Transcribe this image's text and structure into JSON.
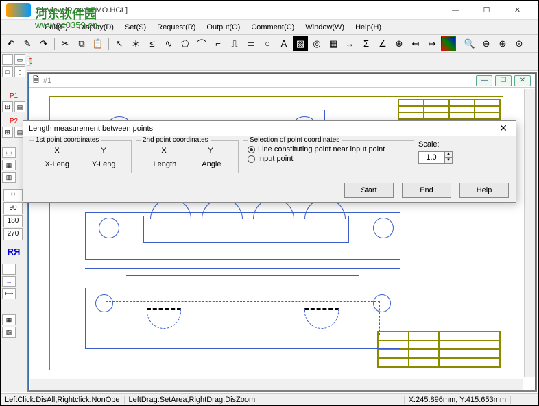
{
  "window": {
    "title": "PlcView [PlcxxDEMO.HGL]"
  },
  "menu": {
    "items": [
      "Edit(E)",
      "Display(D)",
      "Set(S)",
      "Request(R)",
      "Output(O)",
      "Comment(C)",
      "Window(W)",
      "Help(H)"
    ]
  },
  "child": {
    "title": "#1"
  },
  "rotation_buttons": [
    "0",
    "90",
    "180",
    "270"
  ],
  "dialog": {
    "title": "Length measurement between points",
    "group1_label": "1st point coordinates",
    "group2_label": "2nd point coordinates",
    "x_label": "X",
    "y_label": "Y",
    "xleng": "X-Leng",
    "yleng": "Y-Leng",
    "length": "Length",
    "angle": "Angle",
    "sel_label": "Selection of point coordinates",
    "radio1": "Line constituting point near input point",
    "radio2": "Input point",
    "scale_label": "Scale:",
    "scale_value": "1.0",
    "buttons": {
      "start": "Start",
      "end": "End",
      "help": "Help"
    }
  },
  "status": {
    "left": "LeftClick:DisAll,Rightclick:NonOpe",
    "mid": "LeftDrag:SetArea,RightDrag:DisZoom",
    "coords": "X:245.896mm, Y:415.653mm"
  },
  "watermark": {
    "main": "河东软件园",
    "sub": "www.pc0359.cn"
  },
  "left_labels": {
    "p1": "P1",
    "p2": "P2",
    "rr": "RЯ"
  }
}
